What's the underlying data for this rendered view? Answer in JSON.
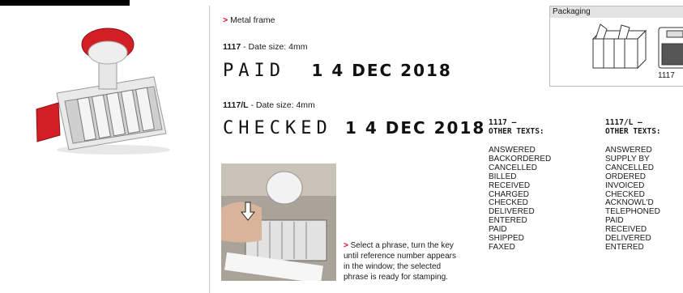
{
  "feature": {
    "arrow": ">",
    "text": "Metal frame"
  },
  "model1": {
    "code": "1117",
    "desc": " - Date size: 4mm",
    "stamp_word": "PAID",
    "stamp_date": "1 4 DEC 2018"
  },
  "model2": {
    "code": "1117/L",
    "desc": " - Date size: 4mm",
    "stamp_word": "CHECKED",
    "stamp_date": "1 4 DEC 2018"
  },
  "instructions": {
    "arrow": ">",
    "text": "Select a phrase, turn the key until reference number appears in the window; the selected phrase is ready for stamping."
  },
  "col1": {
    "heading1": "1117 –",
    "heading2": "OTHER TEXTS:",
    "items": [
      "ANSWERED",
      "BACKORDERED",
      "CANCELLED",
      "BILLED",
      "RECEIVED",
      "CHARGED",
      "CHECKED",
      "DELIVERED",
      "ENTERED",
      "PAID",
      "SHIPPED",
      "FAXED"
    ]
  },
  "col2": {
    "heading1": "1117/L –",
    "heading2": "OTHER TEXTS:",
    "items": [
      "ANSWERED",
      "SUPPLY BY",
      "CANCELLED",
      "ORDERED",
      "INVOICED",
      "CHECKED",
      "ACKNOWL'D",
      "TELEPHONED",
      "PAID",
      "RECEIVED",
      "DELIVERED",
      "ENTERED"
    ]
  },
  "packaging": {
    "title": "Packaging",
    "code": "1117"
  },
  "colors": {
    "accent": "#e1001a",
    "handle": "#d21f26"
  }
}
